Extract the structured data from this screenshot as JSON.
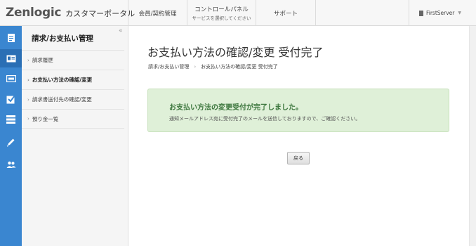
{
  "header": {
    "logo": "Zenlogic",
    "logo_sub": "カスタマーポータル",
    "nav": [
      {
        "label": "会員/契約管理",
        "sub": ""
      },
      {
        "label": "コントロールパネル",
        "sub": "サービスを選択してください"
      },
      {
        "label": "サポート",
        "sub": ""
      }
    ],
    "user": "FirstServer",
    "user_caret": "▼"
  },
  "rail": {
    "icons": [
      "document-icon",
      "id-card-icon",
      "card-icon",
      "checkbox-icon",
      "server-icon",
      "pencil-icon",
      "users-icon"
    ],
    "active_index": 1,
    "color": "#3a86d0"
  },
  "sidebar": {
    "collapse": "«",
    "title": "請求/お支払い管理",
    "items": [
      {
        "label": "請求履歴"
      },
      {
        "label": "お支払い方法の確認/変更"
      },
      {
        "label": "請求書送付先の確認/変更"
      },
      {
        "label": "預り金一覧"
      }
    ],
    "active_index": 1
  },
  "main": {
    "title": "お支払い方法の確認/変更 受付完了",
    "breadcrumb": [
      "請求/お支払い管理",
      "お支払い方法の確認/変更 受付完了"
    ],
    "alert": {
      "title": "お支払い方法の変更受付が完了しました。",
      "message": "通知メールアドレス宛に受付完了のメールを送信しておりますので、ご確認ください。",
      "color": "#dff0d8"
    },
    "back_button": "戻る"
  }
}
